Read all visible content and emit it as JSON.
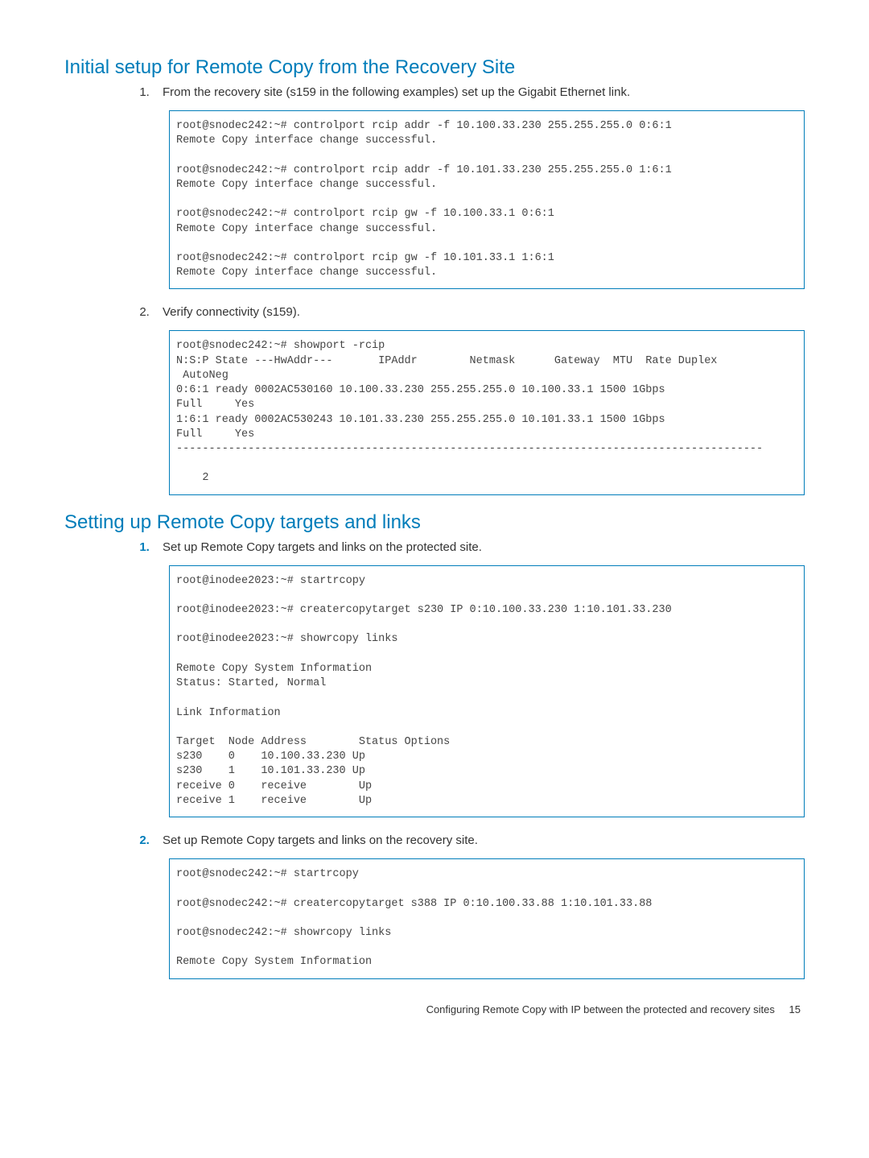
{
  "section1": {
    "heading": "Initial setup for Remote Copy from the Recovery Site",
    "step1": "From the recovery site (s159 in the following examples) set up the Gigabit Ethernet link.",
    "code1": "root@snodec242:~# controlport rcip addr -f 10.100.33.230 255.255.255.0 0:6:1\nRemote Copy interface change successful.\n\nroot@snodec242:~# controlport rcip addr -f 10.101.33.230 255.255.255.0 1:6:1\nRemote Copy interface change successful.\n\nroot@snodec242:~# controlport rcip gw -f 10.100.33.1 0:6:1\nRemote Copy interface change successful.\n\nroot@snodec242:~# controlport rcip gw -f 10.101.33.1 1:6:1\nRemote Copy interface change successful.",
    "step2": "Verify connectivity (s159).",
    "code2": "root@snodec242:~# showport -rcip\nN:S:P State ---HwAddr---       IPAddr        Netmask      Gateway  MTU  Rate Duplex\n AutoNeg\n0:6:1 ready 0002AC530160 10.100.33.230 255.255.255.0 10.100.33.1 1500 1Gbps\nFull     Yes\n1:6:1 ready 0002AC530243 10.101.33.230 255.255.255.0 10.101.33.1 1500 1Gbps\nFull     Yes\n------------------------------------------------------------------------------------------\n  \n    2"
  },
  "section2": {
    "heading": "Setting up Remote Copy targets and links",
    "step1": "Set up Remote Copy targets and links on the protected site.",
    "code1": "root@inodee2023:~# startrcopy\n\nroot@inodee2023:~# creatercopytarget s230 IP 0:10.100.33.230 1:10.101.33.230\n\nroot@inodee2023:~# showrcopy links\n\nRemote Copy System Information\nStatus: Started, Normal\n\nLink Information\n\nTarget  Node Address        Status Options\ns230    0    10.100.33.230 Up\ns230    1    10.101.33.230 Up\nreceive 0    receive        Up\nreceive 1    receive        Up",
    "step2": "Set up Remote Copy targets and links on the recovery site.",
    "code2": "root@snodec242:~# startrcopy\n\nroot@snodec242:~# creatercopytarget s388 IP 0:10.100.33.88 1:10.101.33.88\n\nroot@snodec242:~# showrcopy links\n\nRemote Copy System Information"
  },
  "footer": {
    "text": "Configuring Remote Copy with IP between the protected and recovery sites",
    "page": "15"
  }
}
